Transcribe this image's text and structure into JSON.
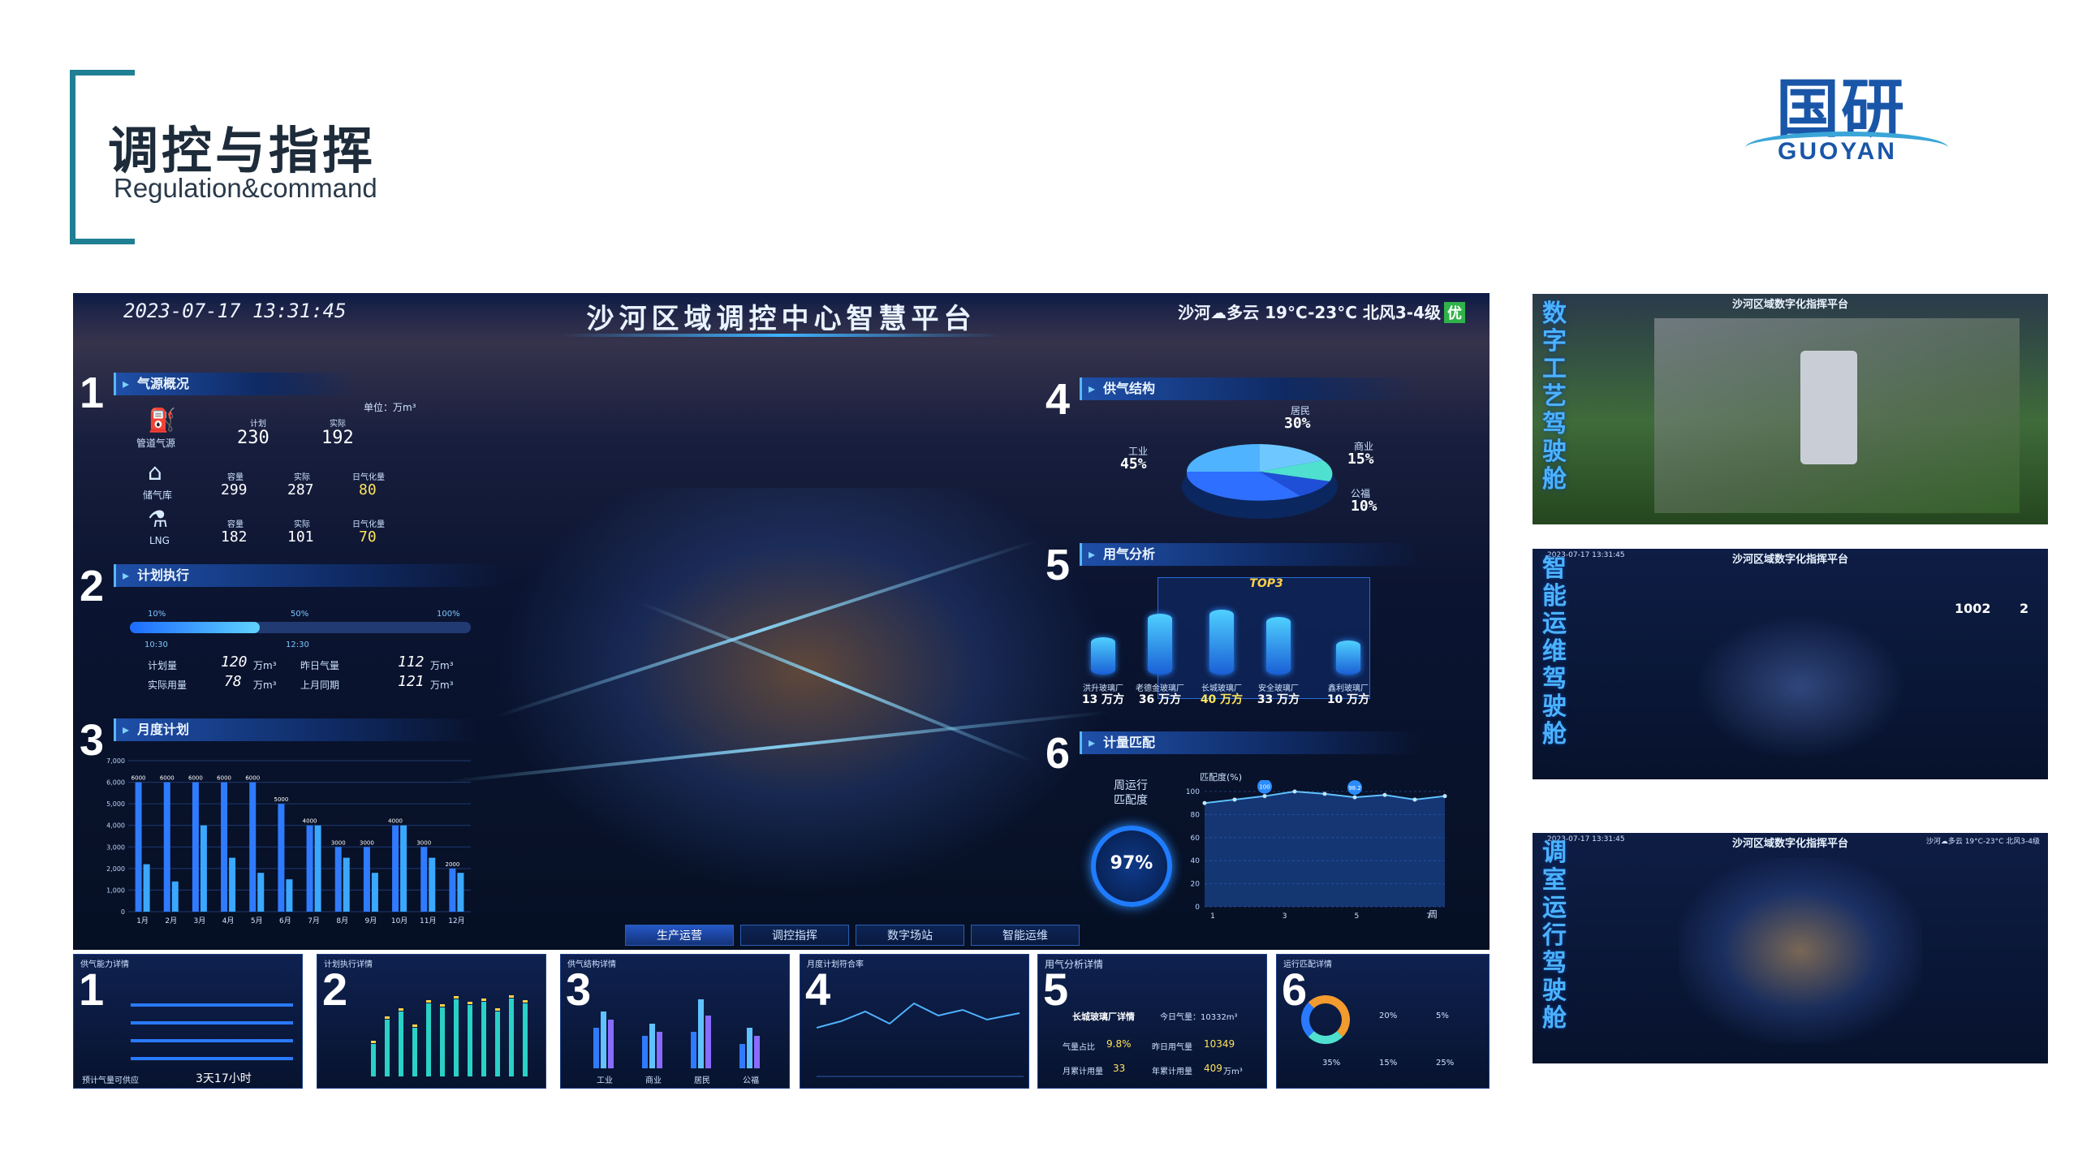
{
  "header": {
    "title_cn": "调控与指挥",
    "title_en": "Regulation&command",
    "logo_cn": "国研",
    "logo_en": "GUOYAN",
    "accent_color": "#1f7f93"
  },
  "main": {
    "datetime": "2023-07-17 13:31:45",
    "title": "沙河区域调控中心智慧平台",
    "weather": "沙河☁多云 19°C-23°C 北风3-4级",
    "air_quality": "优",
    "panels": {
      "p1": {
        "num": "1",
        "title": "气源概况",
        "unit": "单位：万m³",
        "rows": [
          {
            "name": "管道气源",
            "c1_label": "计划",
            "c1_value": "230",
            "c2_label": "实际",
            "c2_value": "192"
          },
          {
            "name": "储气库",
            "c1_label": "容量",
            "c1_value": "299",
            "c2_label": "实际",
            "c2_value": "287",
            "c3_label": "日气化量",
            "c3_value": "80"
          },
          {
            "name": "LNG",
            "c1_label": "容量",
            "c1_value": "182",
            "c2_label": "实际",
            "c2_value": "101",
            "c3_label": "日气化量",
            "c3_value": "70"
          }
        ]
      },
      "p2": {
        "num": "2",
        "title": "计划执行",
        "progress": 0.38,
        "marks": [
          "10%",
          "50%",
          "100%"
        ],
        "times": [
          "10:30",
          "12:30"
        ],
        "plan_label": "计划量",
        "plan_value": "120",
        "yesterday_label": "昨日气量",
        "yesterday_value": "112",
        "actual_label": "实际用量",
        "actual_value": "78",
        "lastmonth_label": "上月同期",
        "lastmonth_value": "121",
        "unit": "万m³"
      },
      "p3": {
        "num": "3",
        "title": "月度计划"
      },
      "p4": {
        "num": "4",
        "title": "供气结构",
        "slices": [
          {
            "name": "工业",
            "value": "45%"
          },
          {
            "name": "居民",
            "value": "30%"
          },
          {
            "name": "商业",
            "value": "15%"
          },
          {
            "name": "公福",
            "value": "10%"
          }
        ]
      },
      "p5": {
        "num": "5",
        "title": "用气分析",
        "top_label": "TOP3",
        "factories": [
          {
            "name": "洪升玻璃厂",
            "value": "13",
            "unit": "万方"
          },
          {
            "name": "老德金玻璃厂",
            "value": "36",
            "unit": "万方"
          },
          {
            "name": "长城玻璃厂",
            "value": "40",
            "unit": "万方"
          },
          {
            "name": "安全玻璃厂",
            "value": "33",
            "unit": "万方"
          },
          {
            "name": "鑫利玻璃厂",
            "value": "10",
            "unit": "万方"
          }
        ]
      },
      "p6": {
        "num": "6",
        "title": "计量匹配",
        "label_line1": "周运行",
        "label_line2": "匹配度",
        "gauge_value": "97%",
        "axis_label": "匹配度(%)",
        "x_label": "周"
      }
    },
    "tabs": [
      "生产运营",
      "调控指挥",
      "数字场站",
      "智能运维"
    ]
  },
  "thumbs": [
    {
      "num": "1",
      "title": "供气能力详情",
      "subtitle": "预计气量可供应",
      "days": "3天17小时"
    },
    {
      "num": "2",
      "title": "计划执行详情"
    },
    {
      "num": "3",
      "title": "供气结构详情",
      "cats": [
        "工业",
        "商业",
        "居民",
        "公福"
      ]
    },
    {
      "num": "4",
      "title": "月度计划符合率"
    },
    {
      "num": "5",
      "title": "用气分析详情",
      "factory": "长城玻璃厂详情",
      "today": "今日气量：10332m³",
      "ratio_label": "气量占比",
      "ratio": "9.8%",
      "yesterday_label": "昨日用气量",
      "yesterday": "10349",
      "month_label": "月累计用量",
      "month": "33",
      "year_label": "年累计用量",
      "year": "409",
      "unit": "万m³"
    },
    {
      "num": "6",
      "title": "运行匹配详情",
      "values": [
        "20%",
        "5%",
        "15%",
        "25%",
        "35%"
      ]
    }
  ],
  "right_cards": [
    {
      "side": "数字工艺驾驶舱",
      "title": "沙河区域数字化指挥平台"
    },
    {
      "side": "智能运维驾驶舱",
      "title": "沙河区域数字化指挥平台",
      "date": "2023-07-17 13:31:45",
      "value1": "1002",
      "value2": "2"
    },
    {
      "side": "调室运行驾驶舱",
      "title": "沙河区域数字化指挥平台",
      "date": "2023-07-17 13:31:45",
      "weather": "沙河☁多云 19°C-23°C 北风3-4级"
    }
  ],
  "chart_data": [
    {
      "type": "bar",
      "title": "月度计划",
      "categories": [
        "1月",
        "2月",
        "3月",
        "4月",
        "5月",
        "6月",
        "7月",
        "8月",
        "9月",
        "10月",
        "11月",
        "12月"
      ],
      "series": [
        {
          "values": [
            6000,
            6000,
            6000,
            6000,
            6000,
            5000,
            4000,
            3000,
            3000,
            4000,
            3000,
            2000
          ]
        },
        {
          "values": [
            2200,
            1400,
            4000,
            2500,
            1800,
            1500,
            4000,
            2500,
            1800,
            4000,
            2500,
            1800
          ]
        }
      ],
      "ylim": [
        0,
        7000
      ],
      "yticks": [
        "0",
        "1,000",
        "2,000",
        "3,000",
        "4,000",
        "5,000",
        "6,000",
        "7,000"
      ]
    },
    {
      "type": "line",
      "title": "计量匹配",
      "x": [
        "1",
        "3",
        "5",
        "7"
      ],
      "values": [
        90,
        93,
        96,
        100,
        98,
        95,
        97,
        93,
        96
      ],
      "ylim": [
        0,
        100
      ],
      "yticks": [
        "0",
        "20",
        "40",
        "60",
        "80",
        "100"
      ],
      "markers": [
        {
          "x": 3,
          "label": "100"
        },
        {
          "x": 6,
          "label": "98.2"
        }
      ]
    }
  ]
}
